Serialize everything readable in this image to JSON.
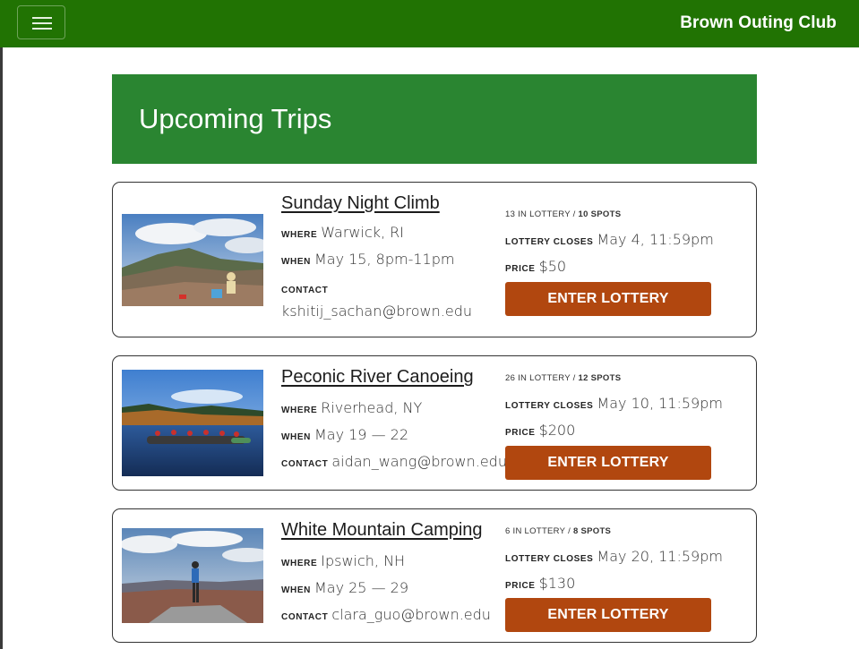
{
  "navbar": {
    "brand": "Brown Outing Club",
    "menu_icon": "hamburger-icon",
    "color": "#217303"
  },
  "hero": {
    "title": "Upcoming Trips",
    "color": "#2a8531"
  },
  "labels": {
    "where": "where",
    "when": "when",
    "contact": "contact",
    "lottery_closes": "lottery closes",
    "price": "price",
    "enter_lottery": "Enter Lottery"
  },
  "accent_button_color": "#b1470f",
  "trips": [
    {
      "title": "Sunday Night Climb",
      "where": "Warwick, RI",
      "when": "May 15, 8pm-11pm",
      "contact": "kshitij_sachan@brown.edu",
      "lottery_count": "13 in lottery /",
      "spots": "10 spots",
      "lottery_closes": "May 4, 11:59pm",
      "price": "$50",
      "image": "mountain summit photo"
    },
    {
      "title": "Peconic River Canoeing",
      "where": "Riverhead, NY",
      "when": "May 19 — 22",
      "contact": "aidan_wang@brown.edu",
      "lottery_count": "26 in lottery /",
      "spots": "12 spots",
      "lottery_closes": "May 10, 11:59pm",
      "price": "$200",
      "image": "canoes on lake photo"
    },
    {
      "title": "White Mountain Camping",
      "where": "Ipswich, NH",
      "when": "May 25 — 29",
      "contact": "clara_guo@brown.edu",
      "lottery_count": "6 in lottery /",
      "spots": "8 spots",
      "lottery_closes": "May 20, 11:59pm",
      "price": "$130",
      "image": "hiker on summit photo"
    }
  ]
}
